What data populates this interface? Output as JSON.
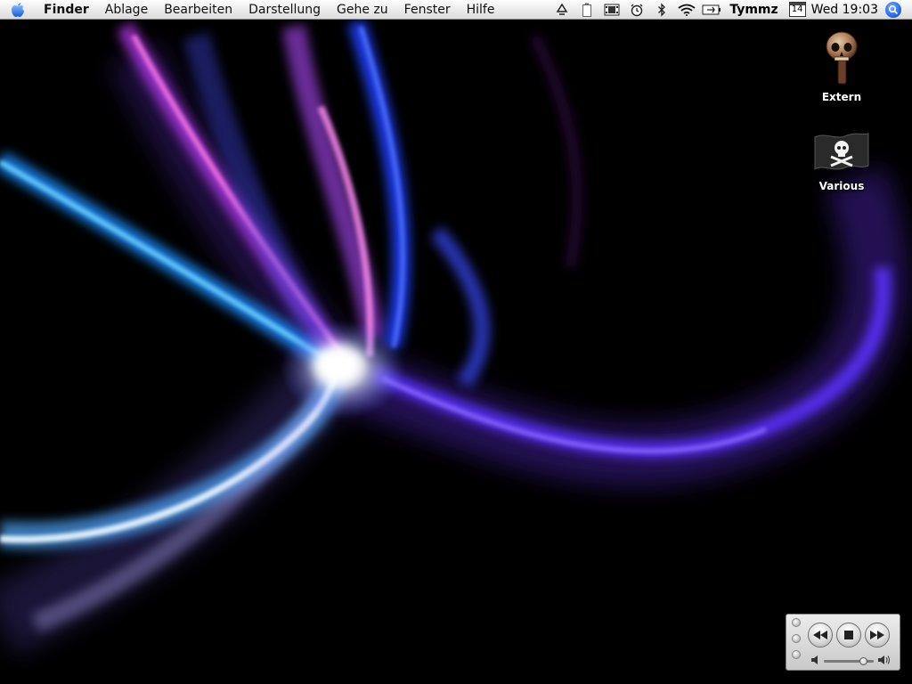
{
  "menubar": {
    "app_name": "Finder",
    "menus": [
      "Ablage",
      "Bearbeiten",
      "Darstellung",
      "Gehe zu",
      "Fenster",
      "Hilfe"
    ],
    "status_icons": [
      "sync-icon",
      "battery-icon",
      "film-icon",
      "alarm-clock-icon",
      "bluetooth-icon",
      "wifi-icon",
      "power-plug-icon"
    ],
    "username": "Tymmz",
    "calendar_day": "14",
    "clock": "Wed 19:03"
  },
  "desktop": {
    "icons": [
      {
        "label": "Extern",
        "icon": "skull-drive-icon"
      },
      {
        "label": "Various",
        "icon": "pirate-flag-icon"
      }
    ]
  },
  "mini_player": {
    "buttons": [
      "rewind-icon",
      "stop-icon",
      "fast-forward-icon"
    ],
    "volume": 0.85
  },
  "colors": {
    "wallpaper_bg": "#000000",
    "menubar_bg": "#ececec",
    "spotlight": "#1b5ee0"
  }
}
